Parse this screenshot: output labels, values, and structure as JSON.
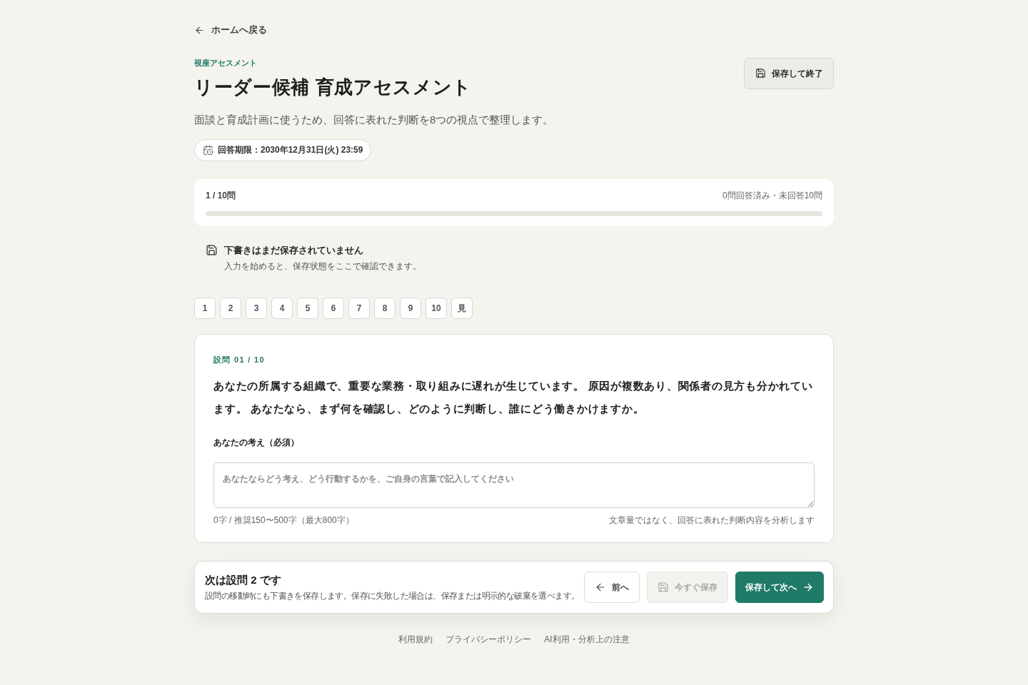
{
  "back_link": {
    "label": "ホームへ戻る"
  },
  "header": {
    "eyebrow": "視座アセスメント",
    "title": "リーダー候補 育成アセスメント",
    "description": "面談と育成計画に使うため、回答に表れた判断を8つの視点で整理します。",
    "deadline": "回答期限：2030年12月31日(火) 23:59",
    "save_exit_button": "保存して終了"
  },
  "progress": {
    "position": "1 / 10問",
    "summary": "0問回答済み・未回答10問"
  },
  "draft_status": {
    "title": "下書きはまだ保存されていません",
    "detail": "入力を始めると、保存状態をここで確認できます。"
  },
  "question_nav": [
    {
      "label": "1",
      "selected": false
    },
    {
      "label": "2",
      "selected": false
    },
    {
      "label": "3",
      "selected": false
    },
    {
      "label": "4",
      "selected": false
    },
    {
      "label": "5",
      "selected": false
    },
    {
      "label": "6",
      "selected": false
    },
    {
      "label": "7",
      "selected": false
    },
    {
      "label": "8",
      "selected": false
    },
    {
      "label": "9",
      "selected": false
    },
    {
      "label": "10",
      "selected": false
    },
    {
      "label": "見",
      "selected": false
    }
  ],
  "question": {
    "number": "設問 01 / 10",
    "text": "あなたの所属する組織で、重要な業務・取り組みに遅れが生じています。 原因が複数あり、関係者の見方も分かれています。 あなたなら、まず何を確認し、どのように判断し、誰にどう働きかけますか。",
    "answer_label": "あなたの考え（必須）",
    "answer": {
      "placeholder": "あなたならどう考え、どう行動するかを、ご自身の言葉で記入してください"
    },
    "counter": "0字 / 推奨150〜500字（最大800字）",
    "note": "文章量ではなく、回答に表れた判断内容を分析します"
  },
  "footer_bar": {
    "title": "次は設問 2 です",
    "detail": "設問の移動時にも下書きを保存します。保存に失敗した場合は、保存または明示的な破棄を選べます。",
    "buttons": [
      {
        "kind": "back",
        "label": "前へ",
        "disabled": false
      },
      {
        "kind": "save",
        "label": "今すぐ保存",
        "disabled": true
      },
      {
        "kind": "next",
        "label": "保存して次へ",
        "disabled": false
      }
    ]
  },
  "footer_links": [
    "利用規約",
    "プライバシーポリシー",
    "AI利用・分析上の注意"
  ]
}
